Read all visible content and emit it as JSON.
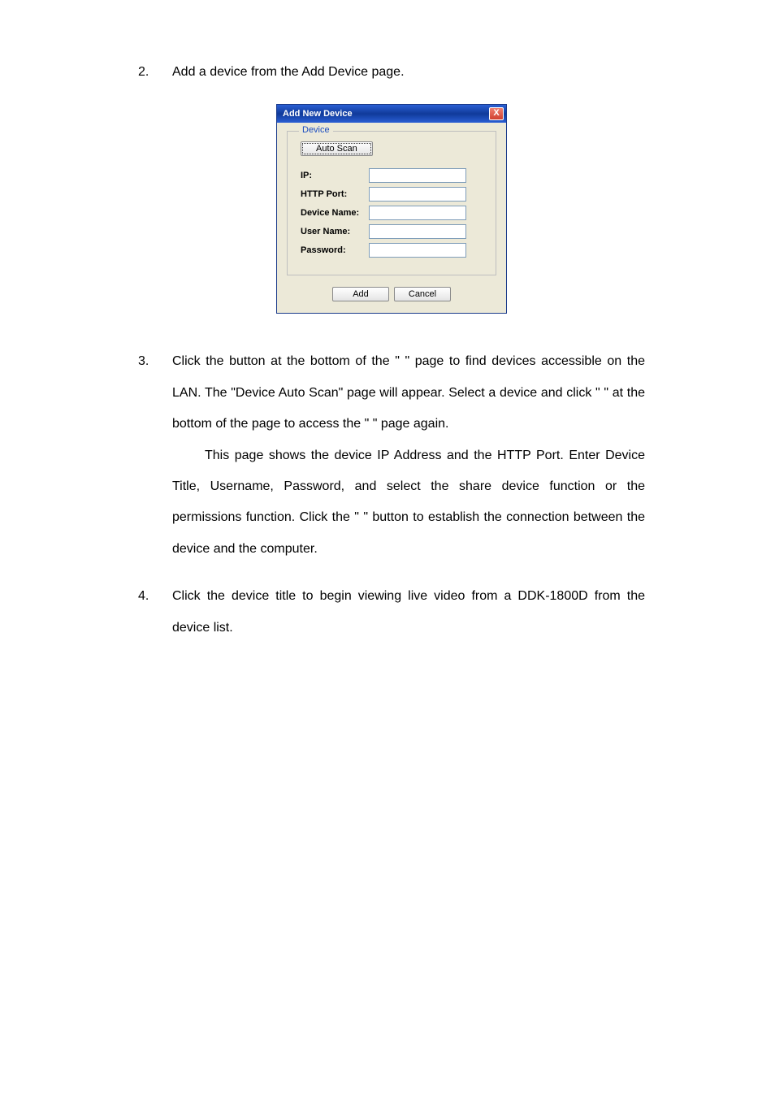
{
  "items": {
    "2": {
      "num": "2.",
      "text": "Add a device from the Add Device page."
    },
    "3": {
      "num": "3.",
      "p1_a": "Click the ",
      "p1_b": " button at the bottom of the \" ",
      "p1_c": " \" page to find devices accessible on the LAN. The \"Device Auto Scan\" page will appear. Select a device and click \" ",
      "p1_d": " \" at the bottom of the page to access the \" ",
      "p1_e": " \" page again.",
      "p2_a": "This page shows the device IP Address and the HTTP Port. Enter Device Title, Username, Password, and select the share device function or the permissions function. Click the \" ",
      "p2_b": " \" button to establish the connection between the device and the computer."
    },
    "4": {
      "num": "4.",
      "text": "Click the device title to begin viewing live video from a DDK-1800D from the device list."
    }
  },
  "dialog": {
    "title": "Add New Device",
    "close": "X",
    "fieldset_legend": "Device",
    "auto_scan": "Auto Scan",
    "labels": {
      "ip": "IP:",
      "http_port": "HTTP Port:",
      "device_name": "Device Name:",
      "user_name": "User Name:",
      "password": "Password:"
    },
    "values": {
      "ip": "",
      "http_port": "",
      "device_name": "",
      "user_name": "",
      "password": ""
    },
    "add": "Add",
    "cancel": "Cancel"
  }
}
